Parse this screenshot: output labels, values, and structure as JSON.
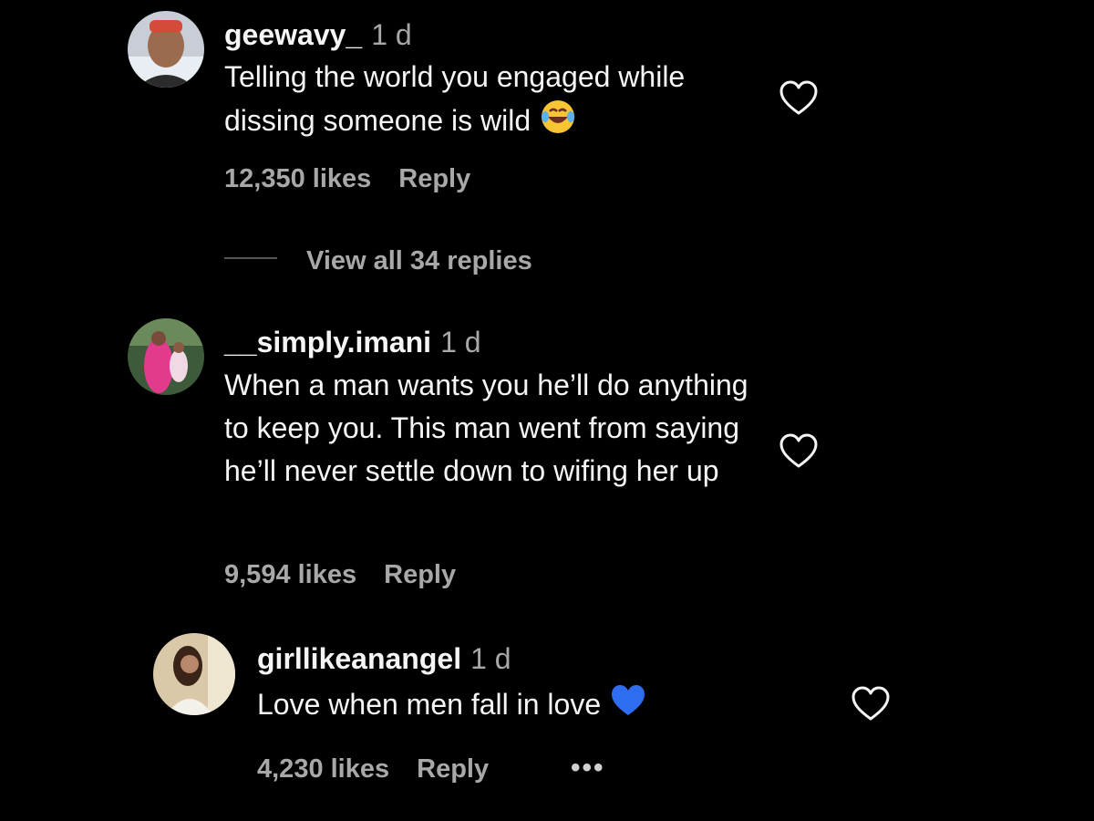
{
  "comments": [
    {
      "username": "geewavy_",
      "time": "1 d",
      "text": "Telling the world you engaged while dissing someone is wild",
      "emoji": "laughing-tears",
      "likes": "12,350 likes",
      "reply_label": "Reply",
      "view_replies": "View all 34 replies"
    },
    {
      "username": "__simply.imani",
      "time": "1 d",
      "text": "When a man wants you he’ll do anything to keep you. This man went from saying he’ll never settle down to wifing her up",
      "likes": "9,594 likes",
      "reply_label": "Reply"
    }
  ],
  "reply": {
    "username": "girllikeanangel",
    "time": "1 d",
    "text": "Love when men fall in love",
    "emoji": "blue-heart",
    "likes": "4,230 likes",
    "reply_label": "Reply",
    "more": "•••"
  },
  "colors": {
    "background": "#000000",
    "text_primary": "#f5f5f5",
    "text_secondary": "#a8a8a8",
    "blue_heart": "#2f6df0"
  }
}
